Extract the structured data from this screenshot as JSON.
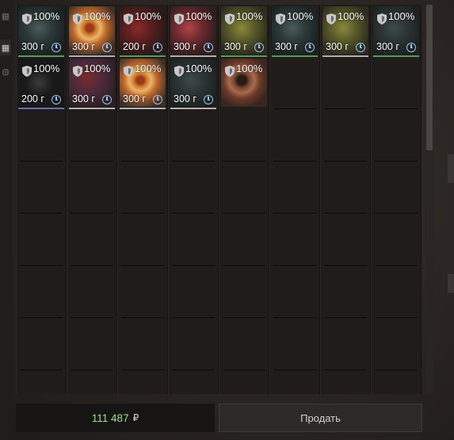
{
  "bottom_bar": {
    "balance": "111 487",
    "currency_icon": "ruble-icon",
    "sell_label": "Продать"
  },
  "items": [
    {
      "condition": "100%",
      "price": "300 г",
      "art": "dark-teal",
      "underline": "#5a9a5a"
    },
    {
      "condition": "100%",
      "price": "300 г",
      "art": "orange-swirl",
      "underline": "#b0b0b0"
    },
    {
      "condition": "100%",
      "price": "200 г",
      "art": "red-gems",
      "underline": "#5a9a5a"
    },
    {
      "condition": "100%",
      "price": "300 г",
      "art": "red-pink",
      "underline": "#b0b0b0"
    },
    {
      "condition": "100%",
      "price": "300 г",
      "art": "olive",
      "underline": "#5a9a5a"
    },
    {
      "condition": "100%",
      "price": "300 г",
      "art": "dark-teal",
      "underline": "#5a9a5a"
    },
    {
      "condition": "100%",
      "price": "300 г",
      "art": "olive",
      "underline": "#b0b0b0"
    },
    {
      "condition": "100%",
      "price": "300 г",
      "art": "dark-slate",
      "underline": "#5a9a5a"
    },
    {
      "condition": "100%",
      "price": "200 г",
      "art": "black",
      "underline": "#6a6ab0"
    },
    {
      "condition": "100%",
      "price": "300 г",
      "art": "mixed-red",
      "underline": "#b0b0b0"
    },
    {
      "condition": "100%",
      "price": "300 г",
      "art": "orange-swirl",
      "underline": "#b0b0b0"
    },
    {
      "condition": "100%",
      "price": "300 г",
      "art": "dark-slate",
      "underline": "#b0b0b0"
    },
    {
      "condition": "100%",
      "price": "",
      "art": "brown-swirl",
      "underline": ""
    }
  ],
  "grid": {
    "columns": 8,
    "rows": 8
  },
  "rail_icons": [
    "grid-small-icon",
    "grid-large-icon",
    "globe-icon"
  ]
}
